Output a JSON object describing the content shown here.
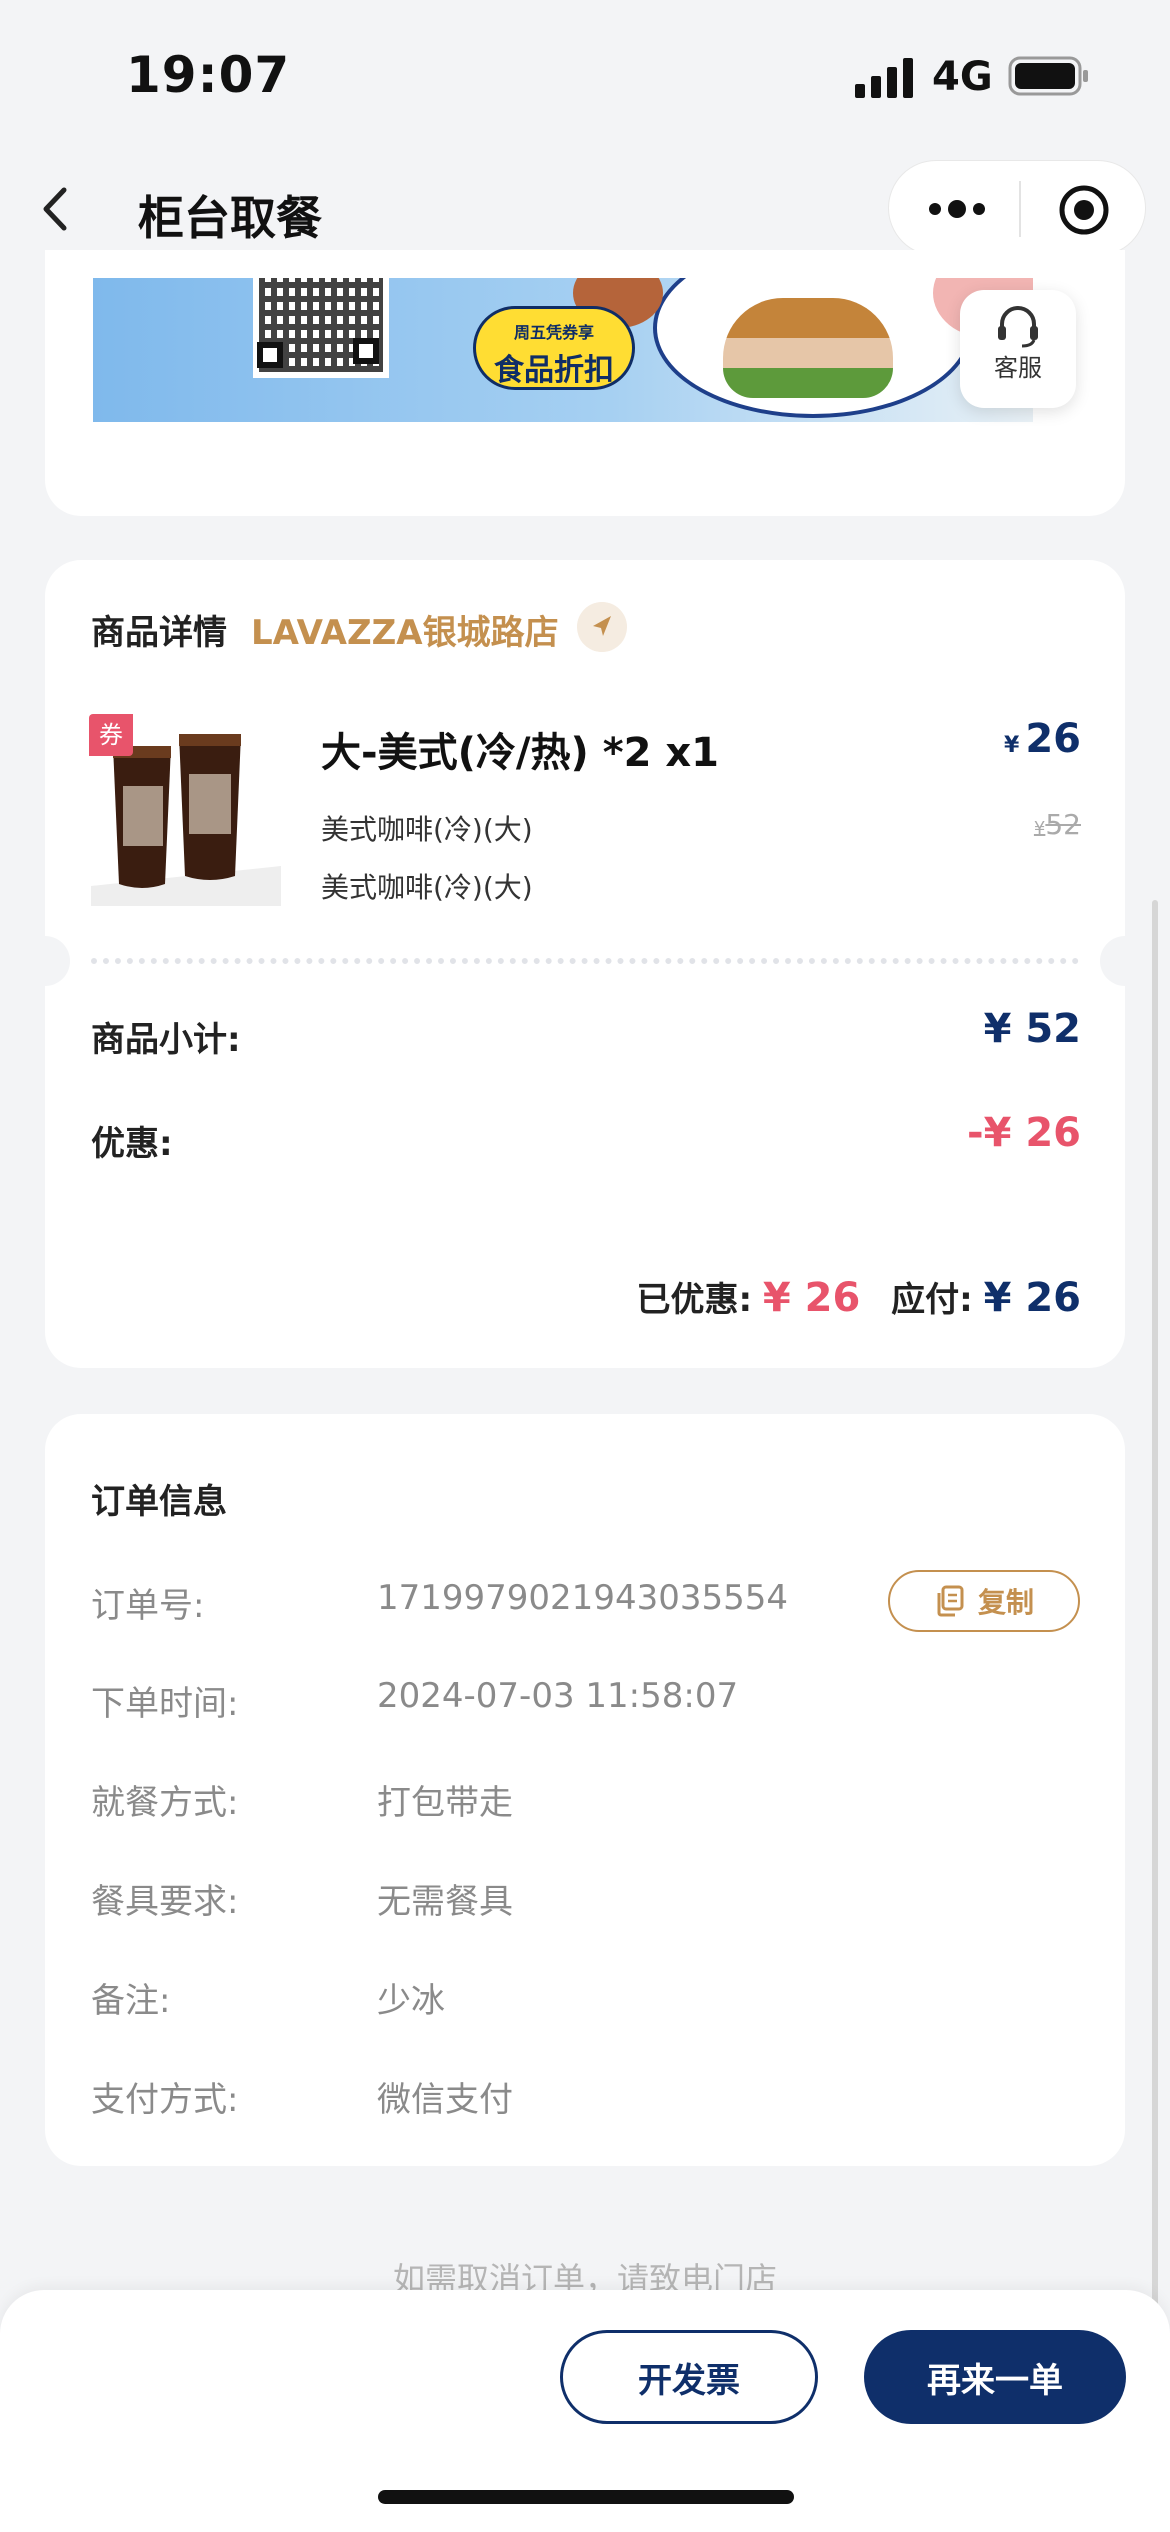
{
  "status_bar": {
    "time": "19:07",
    "network": "4G"
  },
  "nav": {
    "title": "柜台取餐"
  },
  "banner": {
    "promo_small": "周五凭券享",
    "promo_big": "食品折扣",
    "service_label": "客服"
  },
  "product_section": {
    "title": "商品详情",
    "store": "LAVAZZA银城路店",
    "coupon_tag": "券",
    "item": {
      "name": "大-美式(冷/热) *2 x1",
      "price_symbol": "¥",
      "price": "26",
      "old_price_symbol": "¥",
      "old_price": "52",
      "specs": [
        "美式咖啡(冷)(大)",
        "美式咖啡(冷)(大)"
      ]
    },
    "subtotal_label": "商品小计:",
    "subtotal_value": "¥ 52",
    "discount_label": "优惠:",
    "discount_value": "-¥ 26",
    "saved_label": "已优惠:",
    "saved_value": "¥ 26",
    "payable_label": "应付:",
    "payable_value": "¥ 26"
  },
  "order_info": {
    "title": "订单信息",
    "copy_label": "复制",
    "rows": [
      {
        "label": "订单号:",
        "value": "1719979021943035554"
      },
      {
        "label": "下单时间:",
        "value": "2024-07-03 11:58:07"
      },
      {
        "label": "就餐方式:",
        "value": "打包带走"
      },
      {
        "label": "餐具要求:",
        "value": "无需餐具"
      },
      {
        "label": "备注:",
        "value": "少冰"
      },
      {
        "label": "支付方式:",
        "value": "微信支付"
      }
    ]
  },
  "footer": {
    "cancel_note": "如需取消订单，请致电门店",
    "invoice_label": "开发票",
    "reorder_label": "再来一单"
  },
  "colors": {
    "navy": "#0f2f6a",
    "gold": "#c4904f",
    "red": "#e8546b"
  },
  "icons": [
    "signal-icon",
    "battery-icon",
    "back-icon",
    "more-icon",
    "target-icon",
    "headset-icon",
    "location-arrow-icon",
    "copy-icon"
  ]
}
